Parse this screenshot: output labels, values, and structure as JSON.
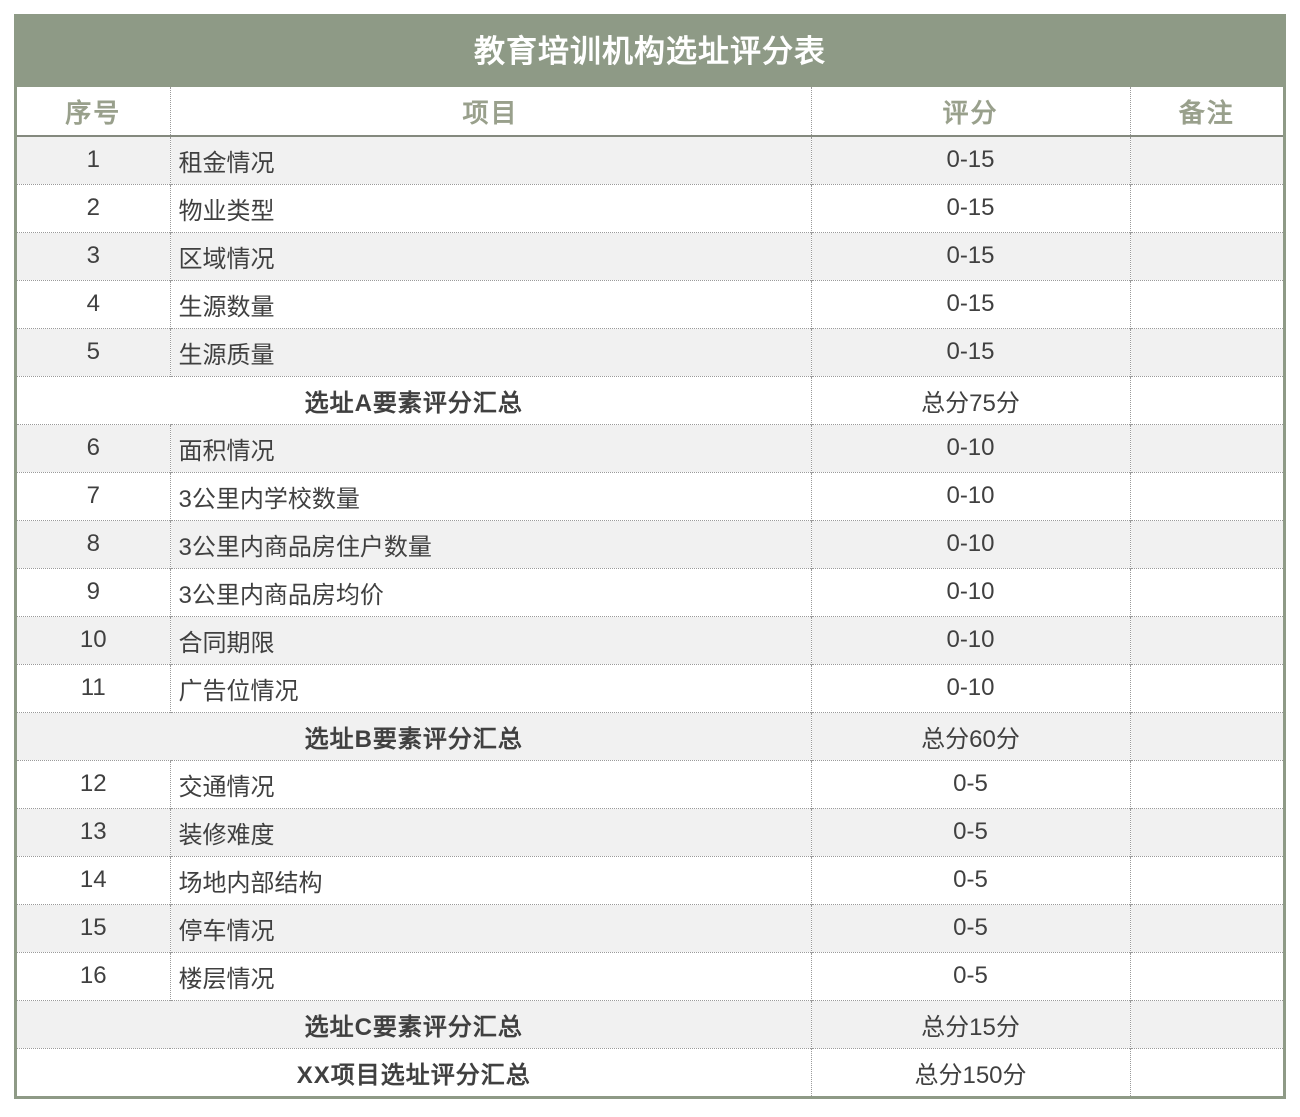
{
  "colors": {
    "accent_green": "#8e9a86",
    "header_text": "#99a08c",
    "header_underline": "#84897e",
    "body_text": "#404040",
    "zebra_gray": "#f1f1f1",
    "dotted_border": "#9a9a9a",
    "title_text": "#ffffff"
  },
  "table": {
    "title": "教育培训机构选址评分表",
    "columns": [
      "序号",
      "项目",
      "评分",
      "备注"
    ],
    "rows": [
      {
        "type": "item",
        "no": "1",
        "item": "租金情况",
        "score": "0-15",
        "note": ""
      },
      {
        "type": "item",
        "no": "2",
        "item": "物业类型",
        "score": "0-15",
        "note": ""
      },
      {
        "type": "item",
        "no": "3",
        "item": "区域情况",
        "score": "0-15",
        "note": ""
      },
      {
        "type": "item",
        "no": "4",
        "item": "生源数量",
        "score": "0-15",
        "note": ""
      },
      {
        "type": "item",
        "no": "5",
        "item": "生源质量",
        "score": "0-15",
        "note": ""
      },
      {
        "type": "summary",
        "label": "选址A要素评分汇总",
        "score": "总分75分",
        "note": ""
      },
      {
        "type": "item",
        "no": "6",
        "item": "面积情况",
        "score": "0-10",
        "note": ""
      },
      {
        "type": "item",
        "no": "7",
        "item": "3公里内学校数量",
        "score": "0-10",
        "note": ""
      },
      {
        "type": "item",
        "no": "8",
        "item": "3公里内商品房住户数量",
        "score": "0-10",
        "note": ""
      },
      {
        "type": "item",
        "no": "9",
        "item": "3公里内商品房均价",
        "score": "0-10",
        "note": ""
      },
      {
        "type": "item",
        "no": "10",
        "item": "合同期限",
        "score": "0-10",
        "note": ""
      },
      {
        "type": "item",
        "no": "11",
        "item": "广告位情况",
        "score": "0-10",
        "note": ""
      },
      {
        "type": "summary",
        "label": "选址B要素评分汇总",
        "score": "总分60分",
        "note": ""
      },
      {
        "type": "item",
        "no": "12",
        "item": "交通情况",
        "score": "0-5",
        "note": ""
      },
      {
        "type": "item",
        "no": "13",
        "item": "装修难度",
        "score": "0-5",
        "note": ""
      },
      {
        "type": "item",
        "no": "14",
        "item": "场地内部结构",
        "score": "0-5",
        "note": ""
      },
      {
        "type": "item",
        "no": "15",
        "item": "停车情况",
        "score": "0-5",
        "note": ""
      },
      {
        "type": "item",
        "no": "16",
        "item": "楼层情况",
        "score": "0-5",
        "note": ""
      },
      {
        "type": "summary",
        "label": "选址C要素评分汇总",
        "score": "总分15分",
        "note": ""
      },
      {
        "type": "summary",
        "label": "XX项目选址评分汇总",
        "score": "总分150分",
        "note": ""
      }
    ]
  }
}
